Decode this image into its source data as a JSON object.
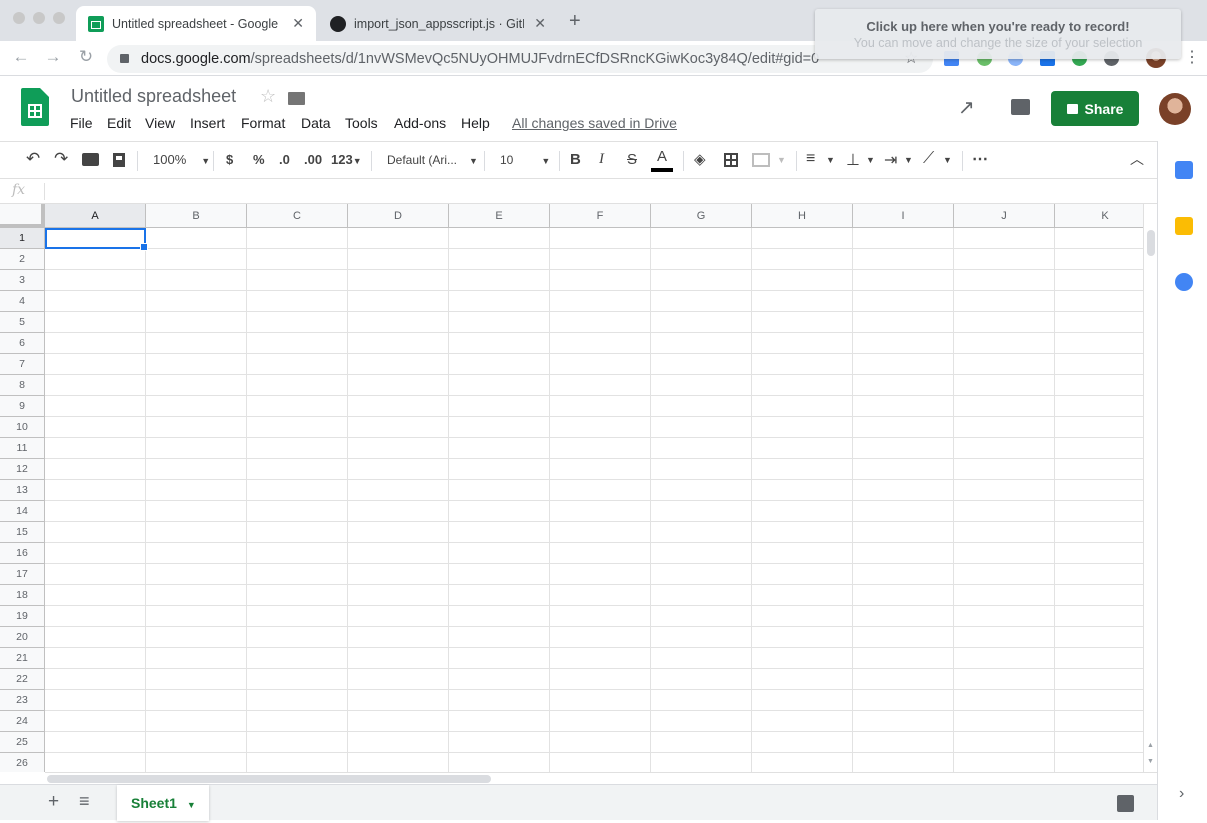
{
  "browser": {
    "tabs": [
      {
        "title": "Untitled spreadsheet - Google Sheets",
        "icon": "google-sheets-icon",
        "active": true
      },
      {
        "title": "import_json_appsscript.js · GitHub",
        "icon": "github-icon",
        "active": false
      }
    ],
    "new_tab": "+",
    "close": "✕",
    "url_host": "docs.google.com",
    "url_path": "/spreadsheets/d/1nvWSMevQc5NUyOHMUJFvdrnECfDSRncKGiwKoc3y84Q/edit#gid=0"
  },
  "recorder_popup": {
    "line1": "Click up here when you're ready to record!",
    "line2": "You can move and change the size of your selection"
  },
  "doc": {
    "title": "Untitled spreadsheet",
    "menus": [
      "File",
      "Edit",
      "View",
      "Insert",
      "Format",
      "Data",
      "Tools",
      "Add-ons",
      "Help"
    ],
    "saved_status": "All changes saved in Drive",
    "share_label": "Share"
  },
  "toolbar": {
    "zoom": "100%",
    "currency": "$",
    "percent": "%",
    "dec_decrease": ".0",
    "dec_increase": ".00",
    "more_formats": "123",
    "font": "Default (Ari...",
    "font_size": "10",
    "bold": "B",
    "italic": "I",
    "strike": "S",
    "text_color": "A",
    "more": "⋯"
  },
  "formula_bar": {
    "fx": "fx",
    "value": ""
  },
  "grid": {
    "columns": [
      "A",
      "B",
      "C",
      "D",
      "E",
      "F",
      "G",
      "H",
      "I",
      "J",
      "K"
    ],
    "rows": [
      "1",
      "2",
      "3",
      "4",
      "5",
      "6",
      "7",
      "8",
      "9",
      "10",
      "11",
      "12",
      "13",
      "14",
      "15",
      "16",
      "17",
      "18",
      "19",
      "20",
      "21",
      "22",
      "23",
      "24",
      "25",
      "26"
    ],
    "selected_cell": "A1"
  },
  "sheets": {
    "tabs": [
      "Sheet1"
    ],
    "add": "+",
    "list": "≡"
  },
  "colors": {
    "sheets_green": "#0f9d58",
    "share_green": "#188038",
    "selection_blue": "#1a73e8"
  }
}
